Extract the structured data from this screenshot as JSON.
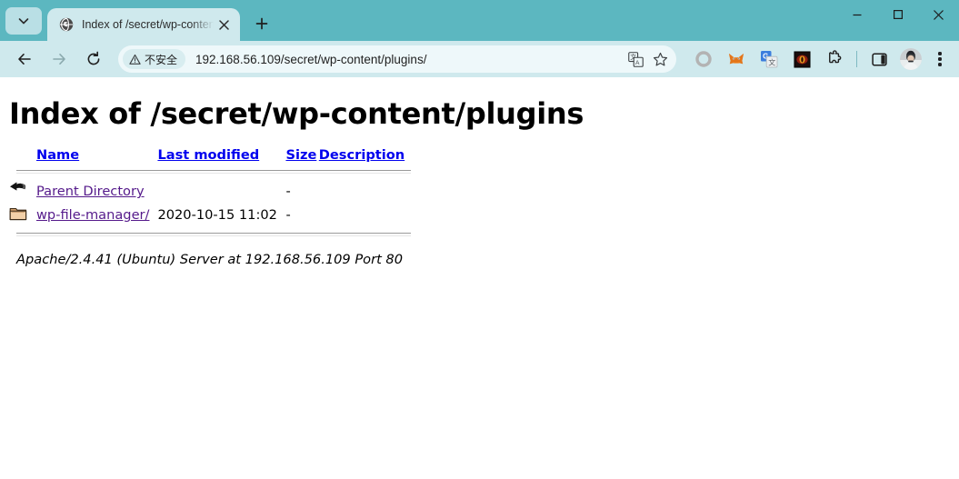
{
  "window": {
    "controls": {
      "minimize": "minimize-button",
      "maximize": "maximize-button",
      "close": "close-button"
    }
  },
  "tabstrip": {
    "tab_search_tooltip": "Search tabs",
    "new_tab_tooltip": "New tab",
    "tabs": [
      {
        "title": "Index of /secret/wp-content/",
        "favicon": "globe-icon",
        "active": true
      }
    ]
  },
  "toolbar": {
    "back_tooltip": "Back",
    "forward_tooltip": "Forward",
    "reload_tooltip": "Reload this page",
    "security_badge": "不安全",
    "url": "192.168.56.109/secret/wp-content/plugins/",
    "url_host": "192.168.56.109",
    "url_path": "/secret/wp-content/plugins/",
    "translate_tooltip": "Translate this page",
    "bookmark_tooltip": "Bookmark this tab",
    "extensions": [
      {
        "name": "ring-extension-icon",
        "tooltip": "Extension"
      },
      {
        "name": "metamask-fox-icon",
        "tooltip": "MetaMask"
      },
      {
        "name": "google-translate-extension-icon",
        "tooltip": "Google Translate"
      },
      {
        "name": "dark-eye-extension-icon",
        "tooltip": "Extension"
      },
      {
        "name": "puzzle-piece-icon",
        "tooltip": "Extensions"
      }
    ],
    "side_panel_tooltip": "Side panel",
    "profile_tooltip": "Profile",
    "menu_tooltip": "Customize and control Google Chrome"
  },
  "page": {
    "heading": "Index of /secret/wp-content/plugins",
    "table": {
      "headers": [
        {
          "label": "Name",
          "name": "sort-by-name"
        },
        {
          "label": "Last modified",
          "name": "sort-by-last-modified"
        },
        {
          "label": "Size",
          "name": "sort-by-size"
        },
        {
          "label": "Description",
          "name": "sort-by-description"
        }
      ],
      "rows": [
        {
          "icon": "parent-directory-icon",
          "name": "Parent Directory",
          "last_modified": "",
          "size": "-",
          "description": ""
        },
        {
          "icon": "folder-icon",
          "name": "wp-file-manager/",
          "last_modified": "2020-10-15 11:02",
          "size": "-",
          "description": ""
        }
      ]
    },
    "server_signature": "Apache/2.4.41 (Ubuntu) Server at 192.168.56.109 Port 80"
  },
  "colors": {
    "tabstrip_bg": "#5cb7c0",
    "toolbar_bg": "#cfe9ed",
    "active_tab_bg": "#cfe9ed",
    "omnibox_bg": "#eef8fa",
    "link_unvisited": "#0000ee",
    "link_visited": "#551a8b"
  }
}
